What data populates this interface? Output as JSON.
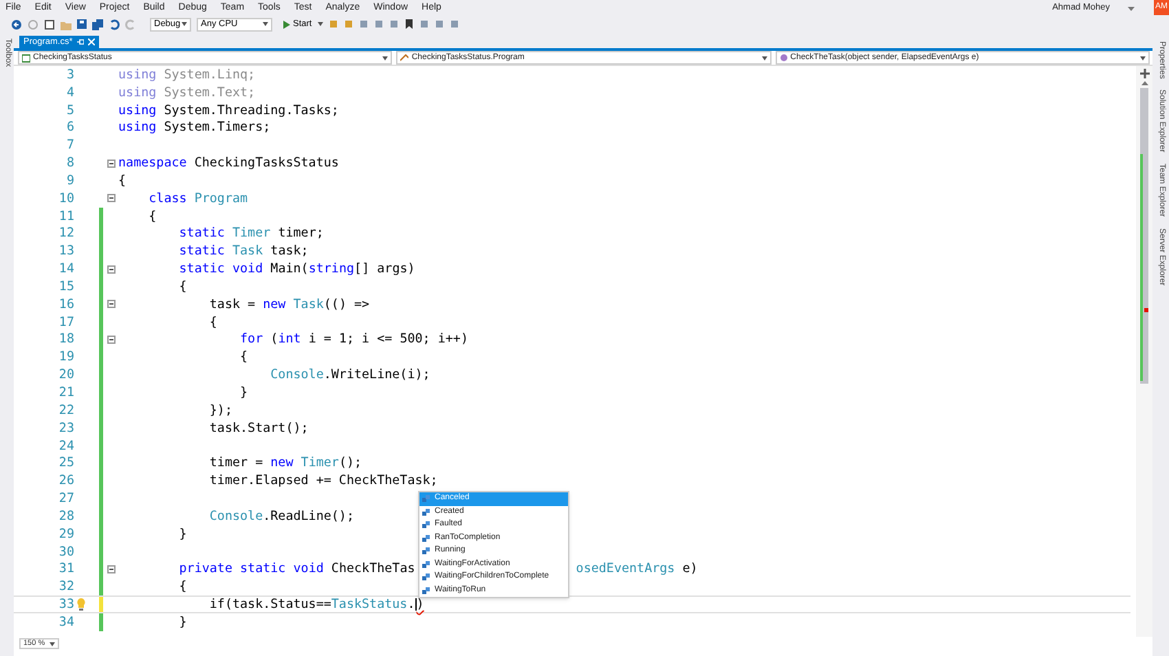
{
  "menu": [
    "File",
    "Edit",
    "View",
    "Project",
    "Build",
    "Debug",
    "Team",
    "Tools",
    "Test",
    "Analyze",
    "Window",
    "Help"
  ],
  "user": {
    "name": "Ahmad Mohey",
    "initials": "AM"
  },
  "toolbar": {
    "configuration": "Debug",
    "platform": "Any CPU",
    "start": "Start"
  },
  "toolbox_label": "Toolbox",
  "tabs": [
    {
      "label": "Program.cs*",
      "selected": true
    }
  ],
  "navigation": [
    "CheckingTasksStatus",
    "CheckingTasksStatus.Program",
    "CheckTheTask(object sender, ElapsedEventArgs e)"
  ],
  "editor": {
    "lines": [
      {
        "number": "3",
        "fold": false,
        "segments": [
          {
            "text": "using",
            "kind": "faded-keyword"
          },
          {
            "text": " System.Linq;",
            "kind": "faded"
          }
        ]
      },
      {
        "number": "4",
        "fold": false,
        "segments": [
          {
            "text": "using",
            "kind": "faded-keyword"
          },
          {
            "text": " System.Text;",
            "kind": "faded"
          }
        ]
      },
      {
        "number": "5",
        "fold": false,
        "segments": [
          {
            "text": "using",
            "kind": "keyword"
          },
          {
            "text": " System.Threading.Tasks;",
            "kind": "plain"
          }
        ]
      },
      {
        "number": "6",
        "fold": false,
        "segments": [
          {
            "text": "using",
            "kind": "keyword"
          },
          {
            "text": " System.Timers;",
            "kind": "plain"
          }
        ]
      },
      {
        "number": "7",
        "fold": false
      },
      {
        "number": "8",
        "fold": true,
        "segments": [
          {
            "text": "namespace",
            "kind": "keyword"
          },
          {
            "text": " CheckingTasksStatus",
            "kind": "plain"
          }
        ]
      },
      {
        "number": "9",
        "fold": false,
        "segments": [
          {
            "text": "{",
            "kind": "plain"
          }
        ]
      },
      {
        "number": "10",
        "fold": true,
        "segments": [
          {
            "text": "    class",
            "kind": "keyword"
          },
          {
            "text": " Program",
            "kind": "type"
          }
        ]
      },
      {
        "number": "11",
        "color": "#57c55a",
        "fold": false,
        "segments": [
          {
            "text": "    {",
            "kind": "plain"
          }
        ]
      },
      {
        "number": "12",
        "color": "#57c55a",
        "fold": false,
        "segments": [
          {
            "text": "        static",
            "kind": "keyword"
          },
          {
            "text": " Timer",
            "kind": "type"
          },
          {
            "text": " timer;",
            "kind": "plain"
          }
        ]
      },
      {
        "number": "13",
        "color": "#57c55a",
        "fold": false,
        "segments": [
          {
            "text": "        static",
            "kind": "keyword"
          },
          {
            "text": " Task",
            "kind": "type"
          },
          {
            "text": " task;",
            "kind": "plain"
          }
        ]
      },
      {
        "number": "14",
        "color": "#57c55a",
        "fold": true,
        "segments": [
          {
            "text": "        static",
            "kind": "keyword"
          },
          {
            "text": " void",
            "kind": "keyword"
          },
          {
            "text": " Main(",
            "kind": "plain"
          },
          {
            "text": "string",
            "kind": "keyword"
          },
          {
            "text": "[] args)",
            "kind": "plain"
          }
        ]
      },
      {
        "number": "15",
        "color": "#57c55a",
        "fold": false,
        "segments": [
          {
            "text": "        {",
            "kind": "plain"
          }
        ]
      },
      {
        "number": "16",
        "color": "#57c55a",
        "fold": true,
        "segments": [
          {
            "text": "            task = ",
            "kind": "plain"
          },
          {
            "text": "new",
            "kind": "keyword"
          },
          {
            "text": " Task",
            "kind": "type"
          },
          {
            "text": "(() =>",
            "kind": "plain"
          }
        ]
      },
      {
        "number": "17",
        "color": "#57c55a",
        "fold": false,
        "segments": [
          {
            "text": "            {",
            "kind": "plain"
          }
        ]
      },
      {
        "number": "18",
        "color": "#57c55a",
        "fold": true,
        "segments": [
          {
            "text": "                for",
            "kind": "keyword"
          },
          {
            "text": " (",
            "kind": "plain"
          },
          {
            "text": "int",
            "kind": "keyword"
          },
          {
            "text": " i = 1; i <= 500; i++)",
            "kind": "plain"
          }
        ]
      },
      {
        "number": "19",
        "color": "#57c55a",
        "fold": false,
        "segments": [
          {
            "text": "                {",
            "kind": "plain"
          }
        ]
      },
      {
        "number": "20",
        "color": "#57c55a",
        "fold": false,
        "segments": [
          {
            "text": "                    Console",
            "kind": "type"
          },
          {
            "text": ".WriteLine(i);",
            "kind": "plain"
          }
        ]
      },
      {
        "number": "21",
        "color": "#57c55a",
        "fold": false,
        "segments": [
          {
            "text": "                }",
            "kind": "plain"
          }
        ]
      },
      {
        "number": "22",
        "color": "#57c55a",
        "fold": false,
        "segments": [
          {
            "text": "            });",
            "kind": "plain"
          }
        ]
      },
      {
        "number": "23",
        "color": "#57c55a",
        "fold": false,
        "segments": [
          {
            "text": "            task.Start();",
            "kind": "plain"
          }
        ]
      },
      {
        "number": "24",
        "color": "#57c55a",
        "fold": false
      },
      {
        "number": "25",
        "color": "#57c55a",
        "fold": false,
        "segments": [
          {
            "text": "            timer = ",
            "kind": "plain"
          },
          {
            "text": "new",
            "kind": "keyword"
          },
          {
            "text": " Timer",
            "kind": "type"
          },
          {
            "text": "();",
            "kind": "plain"
          }
        ]
      },
      {
        "number": "26",
        "color": "#57c55a",
        "fold": false,
        "segments": [
          {
            "text": "            timer.Elapsed += CheckTheTask;",
            "kind": "plain"
          }
        ]
      },
      {
        "number": "27",
        "color": "#57c55a",
        "fold": false
      },
      {
        "number": "28",
        "color": "#57c55a",
        "fold": false,
        "segments": [
          {
            "text": "            Console",
            "kind": "type"
          },
          {
            "text": ".ReadLine();",
            "kind": "plain"
          }
        ]
      },
      {
        "number": "29",
        "color": "#57c55a",
        "fold": false,
        "segments": [
          {
            "text": "        }",
            "kind": "plain"
          }
        ]
      },
      {
        "number": "30",
        "color": "#57c55a",
        "fold": false
      },
      {
        "number": "31",
        "color": "#57c55a",
        "fold": true,
        "segments": [
          {
            "text": "        private",
            "kind": "keyword"
          },
          {
            "text": " static",
            "kind": "keyword"
          },
          {
            "text": " void",
            "kind": "keyword"
          },
          {
            "text": " CheckTheTas",
            "kind": "plain"
          },
          {
            "text": "osedEventArgs",
            "kind": "type",
            "after_gap": true
          },
          {
            "text": " e)",
            "kind": "plain"
          }
        ]
      },
      {
        "number": "32",
        "color": "#57c55a",
        "fold": false,
        "segments": [
          {
            "text": "        {",
            "kind": "plain"
          }
        ]
      },
      {
        "number": "33",
        "color": "#f3e23c",
        "fold": false,
        "current": true,
        "lightbulb": true,
        "segments": [
          {
            "text": "            if(task.Status==",
            "kind": "plain"
          },
          {
            "text": "TaskStatus",
            "kind": "type"
          },
          {
            "text": ".",
            "kind": "plain"
          },
          {
            "text": ")",
            "kind": "error"
          }
        ]
      },
      {
        "number": "34",
        "color": "#57c55a",
        "fold": false,
        "segments": [
          {
            "text": "        }",
            "kind": "plain"
          }
        ]
      }
    ]
  },
  "completion": {
    "items": [
      {
        "label": "Canceled",
        "selected": true
      },
      {
        "label": "Created",
        "selected": false
      },
      {
        "label": "Faulted",
        "selected": false
      },
      {
        "label": "RanToCompletion",
        "selected": false
      },
      {
        "label": "Running",
        "selected": false
      },
      {
        "label": "WaitingForActivation",
        "selected": false
      },
      {
        "label": "WaitingForChildrenToComplete",
        "selected": false
      },
      {
        "label": "WaitingToRun",
        "selected": false
      }
    ]
  },
  "side_tabs": [
    "Properties",
    "Solution Explorer",
    "Team Explorer",
    "Server Explorer"
  ],
  "zoom": "150 %"
}
